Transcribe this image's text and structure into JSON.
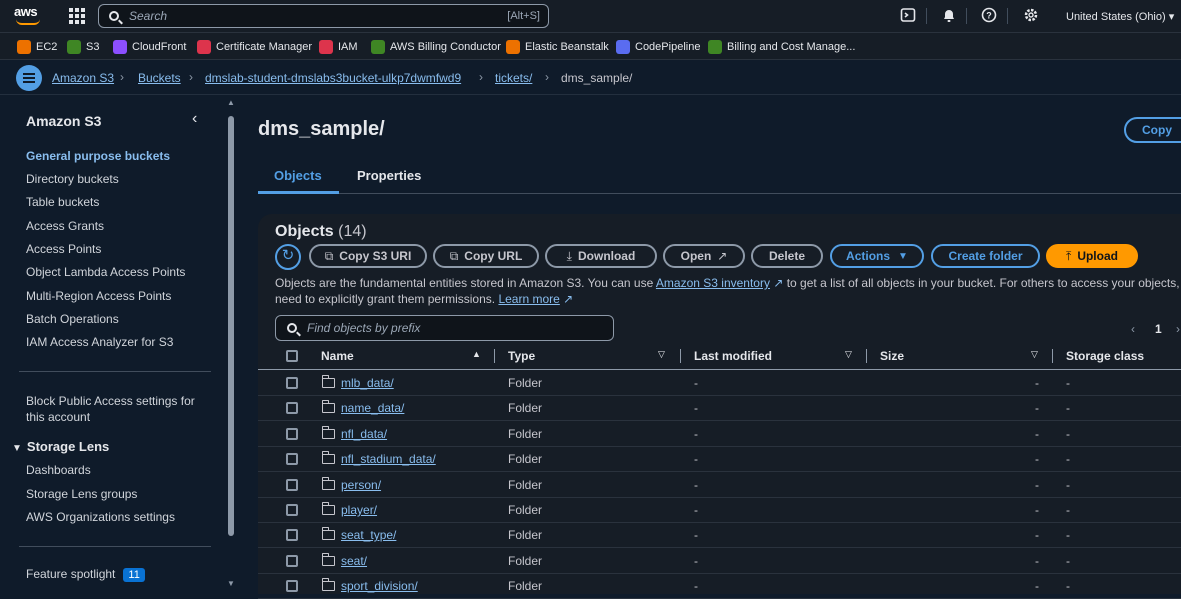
{
  "topbar": {
    "logo": "aws",
    "search_placeholder": "Search",
    "search_shortcut": "[Alt+S]",
    "region": "United States (Ohio) ▾",
    "icons": [
      "services-grid-icon",
      "cloudshell-icon",
      "bell-icon",
      "help-icon",
      "settings-icon"
    ]
  },
  "favorites": [
    {
      "label": "EC2",
      "color": "#ed7100"
    },
    {
      "label": "S3",
      "color": "#3f8624"
    },
    {
      "label": "CloudFront",
      "color": "#8c4fff"
    },
    {
      "label": "Certificate Manager",
      "color": "#dd344c"
    },
    {
      "label": "IAM",
      "color": "#dd344c"
    },
    {
      "label": "AWS Billing Conductor",
      "color": "#3f8624"
    },
    {
      "label": "Elastic Beanstalk",
      "color": "#ed7100"
    },
    {
      "label": "CodePipeline",
      "color": "#5a6cf0"
    },
    {
      "label": "Billing and Cost Manage..."
    }
  ],
  "breadcrumbs": [
    "Amazon S3",
    "Buckets",
    "dmslab-student-dmslabs3bucket-ulkp7dwmfwd9",
    "tickets/",
    "dms_sample/"
  ],
  "sidebar": {
    "title": "Amazon S3",
    "items": [
      "General purpose buckets",
      "Directory buckets",
      "Table buckets",
      "Access Grants",
      "Access Points",
      "Object Lambda Access Points",
      "Multi-Region Access Points",
      "Batch Operations",
      "IAM Access Analyzer for S3"
    ],
    "block_public_line1": "Block Public Access settings for",
    "block_public_line2": "this account",
    "storage_lens": "Storage Lens",
    "storage_lens_items": [
      "Dashboards",
      "Storage Lens groups",
      "AWS Organizations settings"
    ],
    "feature_spotlight": "Feature spotlight",
    "feature_count": "11"
  },
  "main": {
    "title": "dms_sample/",
    "copy_button": "Copy",
    "tabs": [
      "Objects",
      "Properties"
    ],
    "objects_title": "Objects",
    "objects_count": "(14)",
    "buttons": {
      "copy_s3_uri": "Copy S3 URI",
      "copy_url": "Copy URL",
      "download": "Download",
      "open": "Open",
      "delete": "Delete",
      "actions": "Actions",
      "create_folder": "Create folder",
      "upload": "Upload"
    },
    "description_part1": "Objects are the fundamental entities stored in Amazon S3. You can use ",
    "description_link1": "Amazon S3 inventory",
    "description_part2": " to get a list of all objects in your bucket. For others to access your objects, you'll",
    "description_line2": "need to explicitly grant them permissions. ",
    "description_link2": "Learn more",
    "filter_placeholder": "Find objects by prefix",
    "page_number": "1",
    "columns": [
      "Name",
      "Type",
      "Last modified",
      "Size",
      "Storage class"
    ],
    "rows": [
      {
        "name": "mlb_data/",
        "type": "Folder",
        "modified": "-",
        "size": "-",
        "storage": "-"
      },
      {
        "name": "name_data/",
        "type": "Folder",
        "modified": "-",
        "size": "-",
        "storage": "-"
      },
      {
        "name": "nfl_data/",
        "type": "Folder",
        "modified": "-",
        "size": "-",
        "storage": "-"
      },
      {
        "name": "nfl_stadium_data/",
        "type": "Folder",
        "modified": "-",
        "size": "-",
        "storage": "-"
      },
      {
        "name": "person/",
        "type": "Folder",
        "modified": "-",
        "size": "-",
        "storage": "-"
      },
      {
        "name": "player/",
        "type": "Folder",
        "modified": "-",
        "size": "-",
        "storage": "-"
      },
      {
        "name": "seat_type/",
        "type": "Folder",
        "modified": "-",
        "size": "-",
        "storage": "-"
      },
      {
        "name": "seat/",
        "type": "Folder",
        "modified": "-",
        "size": "-",
        "storage": "-"
      },
      {
        "name": "sport_division/",
        "type": "Folder",
        "modified": "-",
        "size": "-",
        "storage": "-"
      }
    ]
  }
}
